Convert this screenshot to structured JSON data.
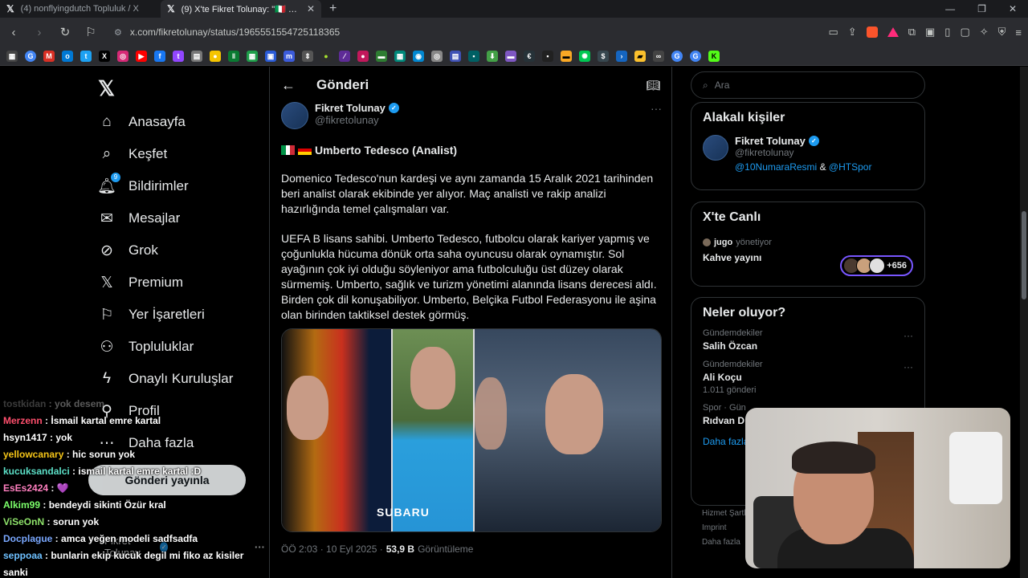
{
  "browser": {
    "tabs": [
      {
        "title": "(4) nonflyingdutch Topluluk / X"
      },
      {
        "title": "(9) X'te Fikret Tolunay: \"🇮🇹 🇩🇪Umb"
      }
    ],
    "url": "x.com/fikretolunay/status/1965551554725118365"
  },
  "nav": {
    "items": [
      {
        "label": "Anasayfa",
        "icon": "home-icon"
      },
      {
        "label": "Keşfet",
        "icon": "search-icon"
      },
      {
        "label": "Bildirimler",
        "icon": "bell-icon",
        "badge": "9"
      },
      {
        "label": "Mesajlar",
        "icon": "mail-icon"
      },
      {
        "label": "Grok",
        "icon": "grok-icon"
      },
      {
        "label": "Premium",
        "icon": "x-icon"
      },
      {
        "label": "Yer İşaretleri",
        "icon": "bookmark-icon"
      },
      {
        "label": "Topluluklar",
        "icon": "people-icon"
      },
      {
        "label": "Onaylı Kuruluşlar",
        "icon": "lightning-icon"
      },
      {
        "label": "Profil",
        "icon": "person-icon"
      },
      {
        "label": "Daha fazla",
        "icon": "more-icon"
      }
    ],
    "post_button": "Gönderi yayınla",
    "account_name": "Fikret Tolunay"
  },
  "main": {
    "header_title": "Gönderi",
    "tweet": {
      "author_name": "Fikret Tolunay",
      "author_handle": "@fikretolunay",
      "title": "Umberto Tedesco (Analist)",
      "paragraph1": "Domenico Tedesco'nun kardeşi ve aynı zamanda 15 Aralık 2021 tarihinden beri analist olarak ekibinde yer alıyor. Maç analisti ve rakip analizi hazırlığında temel çalışmaları var.",
      "paragraph2": "UEFA B lisans sahibi. Umberto Tedesco, futbolcu olarak kariyer yapmış ve çoğunlukla hücuma dönük orta saha oyuncusu olarak oynamıştır. Sol ayağının çok iyi olduğu söyleniyor ama futbolculuğu üst düzey olarak sürmemiş.  Umberto, sağlık ve turizm yönetimi alanında lisans derecesi aldı. Birden çok dil konuşabiliyor.  Umberto, Belçika Futbol Federasyonu ile aşina olan birinden taktiksel destek görmüş.",
      "image_text": "SUBARU",
      "time": "ÖÖ 2:03 · 10 Eyl 2025 ·",
      "views_count": "53,9 B",
      "views_label": "Görüntüleme"
    }
  },
  "sidebar": {
    "search_placeholder": "Ara",
    "related": {
      "title": "Alakalı kişiler",
      "name": "Fikret Tolunay",
      "handle": "@fikretolunay",
      "bio_link1": "@10NumaraResmi",
      "bio_amp": "&",
      "bio_link2": "@HTSpor"
    },
    "live": {
      "title": "X'te Canlı",
      "host": "jugo",
      "host_suffix": "yönetiyor",
      "space_title": "Kahve yayını",
      "listeners": "+656"
    },
    "trends": {
      "title": "Neler oluyor?",
      "items": [
        {
          "category": "Gündemdekiler",
          "name": "Salih Özcan",
          "count": ""
        },
        {
          "category": "Gündemdekiler",
          "name": "Ali Koçu",
          "count": "1.011 gönderi"
        },
        {
          "category": "Spor · Gün",
          "name": "Rıdvan D",
          "count": ""
        }
      ],
      "more": "Daha fazla"
    },
    "footer": [
      "Hizmet Şartl",
      "Imprint",
      "Daha fazla"
    ]
  },
  "chat": [
    {
      "user": "tostkidan",
      "msg": "yok desem",
      "color": "#aaaaaa",
      "faded": true
    },
    {
      "user": "Merzenn",
      "msg": "İsmail kartal emre kartal",
      "color": "#ff4f6d"
    },
    {
      "user": "hsyn1417",
      "msg": "yok",
      "color": "#ffffff"
    },
    {
      "user": "yellowcanary",
      "msg": "hic sorun yok",
      "color": "#f5c518"
    },
    {
      "user": "kucuksandalci",
      "msg": "ismail kartal emre kartal :D",
      "color": "#5ce0c8"
    },
    {
      "user": "EsEs2424",
      "msg": "💜",
      "color": "#ff7fbf"
    },
    {
      "user": "Alkim99",
      "msg": "bendeydi sikinti Özür kral",
      "color": "#7cff6b"
    },
    {
      "user": "ViSeOnN",
      "msg": "sorun yok",
      "color": "#8fe36b"
    },
    {
      "user": "Docplague",
      "msg": "amca yeğen modeli sadfsadfa",
      "color": "#7aa8ff"
    },
    {
      "user": "seppoaa",
      "msg": "bunlarin ekip kucuk degil mi fiko az kisiler",
      "color": "#6ec0ff"
    },
    {
      "user": "",
      "msg": "sanki",
      "color": "#ffffff"
    }
  ],
  "colors": {
    "accent": "#1d9bf0",
    "bg": "#000000",
    "live_border": "#7856ff"
  }
}
